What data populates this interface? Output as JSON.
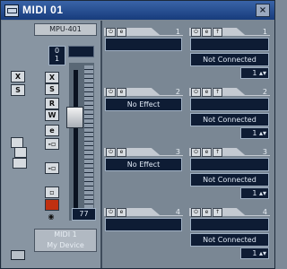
{
  "window": {
    "title": "MIDI 01",
    "close_glyph": "×"
  },
  "channel_strip": {
    "device_name": "MPU-401",
    "program_number": "0",
    "program_sub": "1",
    "buttons": [
      "X",
      "S",
      "R",
      "W"
    ],
    "volume_value": "77",
    "output_port": "MIDI 1",
    "output_device": "My Device"
  },
  "inserts": [
    {
      "number": "1",
      "effect": ""
    },
    {
      "number": "2",
      "effect": "No Effect"
    },
    {
      "number": "3",
      "effect": "No Effect"
    },
    {
      "number": "4",
      "effect": ""
    }
  ],
  "sends": [
    {
      "number": "1",
      "destination": "Not Connected",
      "channel": "1"
    },
    {
      "number": "2",
      "destination": "Not Connected",
      "channel": "1"
    },
    {
      "number": "3",
      "destination": "Not Connected",
      "channel": "1"
    },
    {
      "number": "4",
      "destination": "Not Connected",
      "channel": "1"
    }
  ],
  "colors": {
    "title_bar": "#2a509a",
    "panel_bg": "#7a8794",
    "display_bg": "#0e1c34",
    "record_button": "#c03010"
  }
}
